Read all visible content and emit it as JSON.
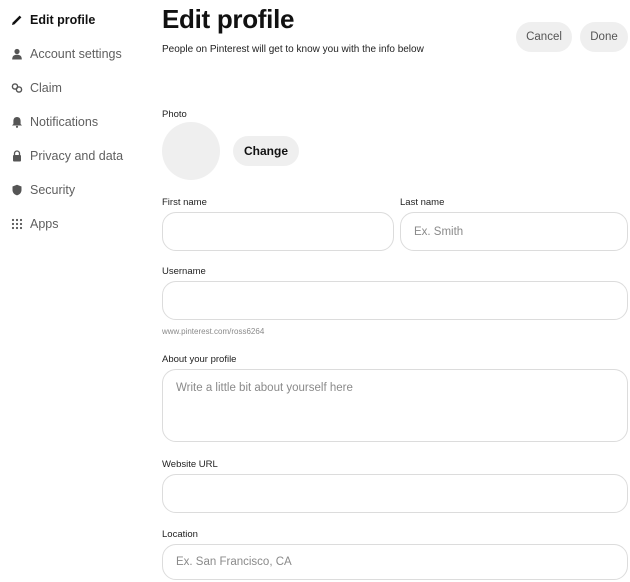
{
  "sidebar": {
    "items": [
      {
        "label": "Edit profile",
        "icon": "pencil-icon"
      },
      {
        "label": "Account settings",
        "icon": "person-icon"
      },
      {
        "label": "Claim",
        "icon": "claim-icon"
      },
      {
        "label": "Notifications",
        "icon": "bell-icon"
      },
      {
        "label": "Privacy and data",
        "icon": "lock-icon"
      },
      {
        "label": "Security",
        "icon": "shield-icon"
      },
      {
        "label": "Apps",
        "icon": "grid-icon"
      }
    ]
  },
  "header": {
    "title": "Edit profile",
    "subtitle": "People on Pinterest will get to know you with the info below",
    "cancel_label": "Cancel",
    "done_label": "Done"
  },
  "form": {
    "photo_label": "Photo",
    "change_label": "Change",
    "first_name": {
      "label": "First name",
      "value": "",
      "placeholder": ""
    },
    "last_name": {
      "label": "Last name",
      "value": "",
      "placeholder": "Ex. Smith"
    },
    "username": {
      "label": "Username",
      "value": "",
      "placeholder": ""
    },
    "username_helper": "www.pinterest.com/ross6264",
    "about": {
      "label": "About your profile",
      "value": "",
      "placeholder": "Write a little bit about yourself here"
    },
    "website": {
      "label": "Website URL",
      "value": "",
      "placeholder": ""
    },
    "location": {
      "label": "Location",
      "value": "",
      "placeholder": "Ex. San Francisco, CA"
    }
  },
  "colors": {
    "background": "#ffffff",
    "button_bg": "#efefef",
    "input_border": "#dcdcdc",
    "text": "#111111"
  }
}
